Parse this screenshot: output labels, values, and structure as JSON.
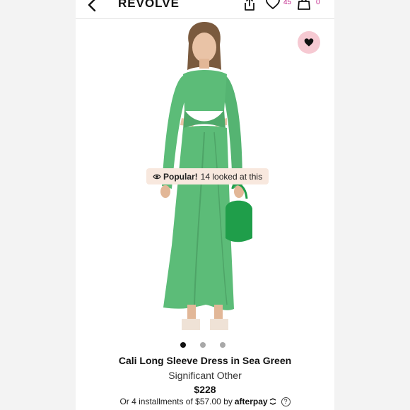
{
  "header": {
    "logo": "REVOLVE",
    "wishlist_count": "45",
    "bag_count": "0",
    "icons": [
      "chevron-left-icon",
      "share-icon",
      "heart-icon",
      "bag-icon"
    ]
  },
  "product": {
    "popular_label": "Popular!",
    "popular_text": "14 looked at this",
    "title": "Cali Long Sleeve Dress in Sea Green",
    "brand": "Significant Other",
    "price": "$228",
    "installments_text": "Or 4 installments of $57.00 by",
    "payment_provider": "afterpay",
    "carousel": {
      "total": 3,
      "active": 1
    }
  },
  "colors": {
    "accent": "#c0258a",
    "favorite_bg": "#f6c9d2",
    "dress": "#5cbc78",
    "bag": "#1f9e4a"
  }
}
